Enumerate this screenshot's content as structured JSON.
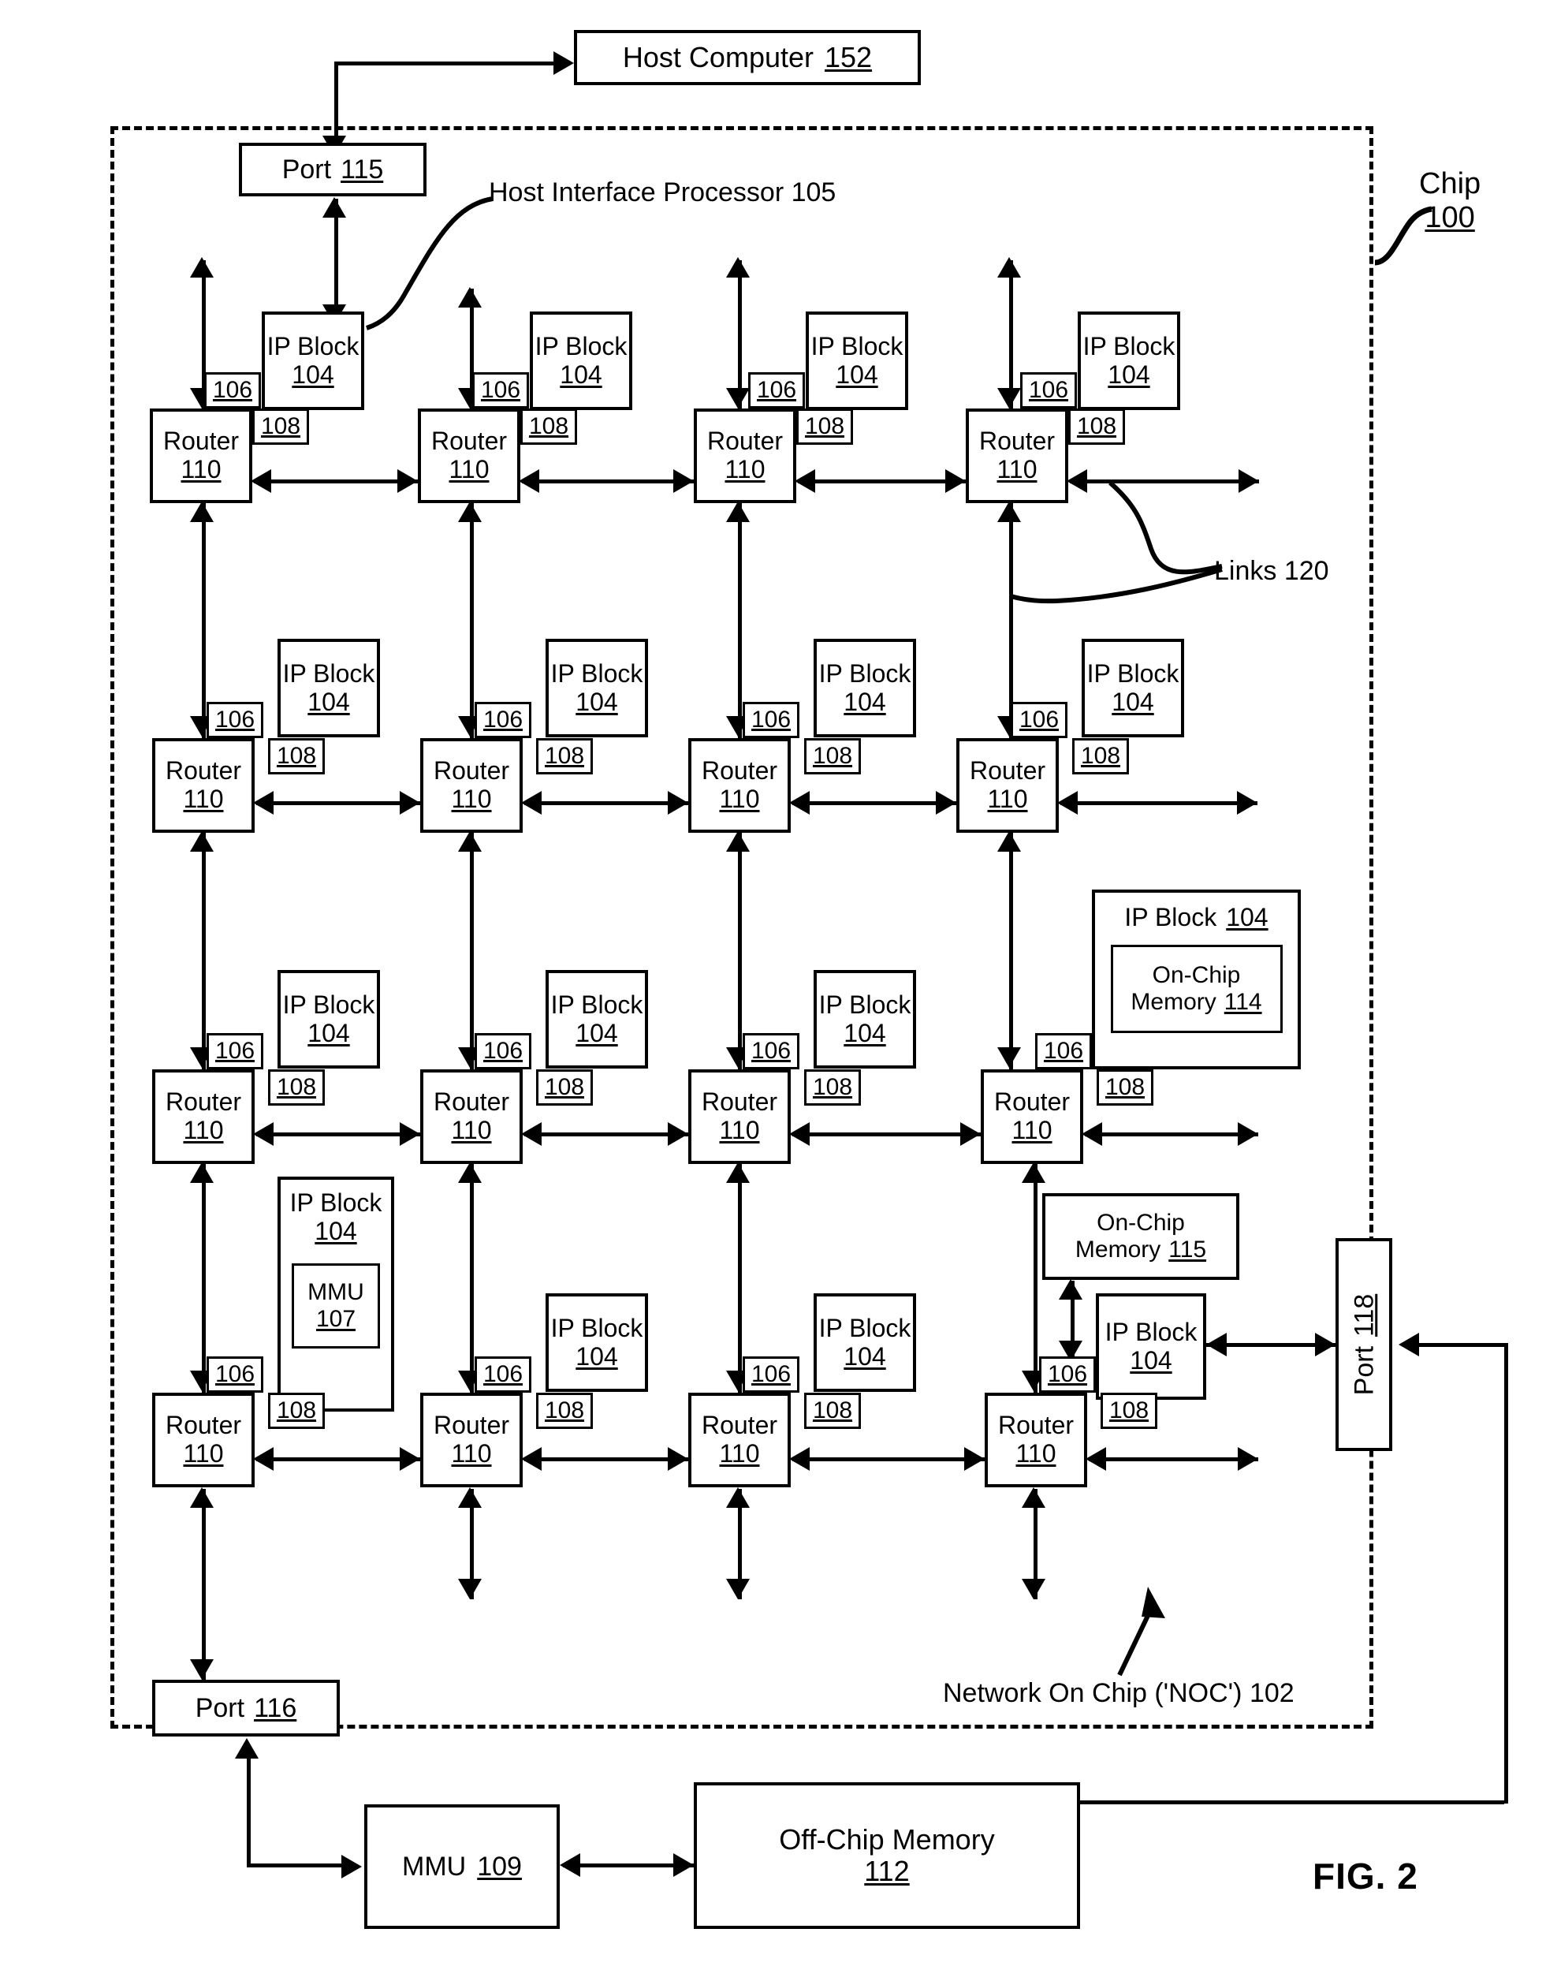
{
  "figure": {
    "caption": "FIG. 2"
  },
  "labels": {
    "chip": {
      "line1": "Chip",
      "line2": "100"
    },
    "host_interface_processor": "Host Interface Processor 105",
    "links": "Links 120",
    "noc": "Network On Chip ('NOC') 102"
  },
  "boxes": {
    "host_computer": {
      "text": "Host Computer",
      "ref": "152"
    },
    "port_115": {
      "text": "Port",
      "ref": "115"
    },
    "port_116": {
      "text": "Port",
      "ref": "116"
    },
    "port_118": {
      "text": "Port",
      "ref": "118"
    },
    "mmu_109": {
      "text": "MMU",
      "ref": "109"
    },
    "off_chip_memory": {
      "line1": "Off-Chip Memory",
      "ref": "112"
    },
    "on_chip_memory_114": {
      "line1": "On-Chip",
      "line2": "Memory",
      "ref": "114"
    },
    "on_chip_memory_115": {
      "line1": "On-Chip",
      "line2": "Memory",
      "ref": "115"
    },
    "mmu_107": {
      "text": "MMU",
      "ref": "107"
    }
  },
  "cell": {
    "router_label": "Router",
    "router_ref": "110",
    "ip_block_label": "IP Block",
    "ip_block_ref": "104",
    "tag_106": "106",
    "tag_108": "108"
  },
  "grid": {
    "rows": 4,
    "cols": 4,
    "note_cells": {
      "r0c0": "connected to Host Interface Processor 105 / Port 115",
      "r2c3": "IP Block 104 contains On-Chip Memory 114",
      "r3c0": "IP Block 104 contains MMU 107",
      "r3c3": "IP Block 104 connected to On-Chip Memory 115 and Port 118"
    }
  }
}
